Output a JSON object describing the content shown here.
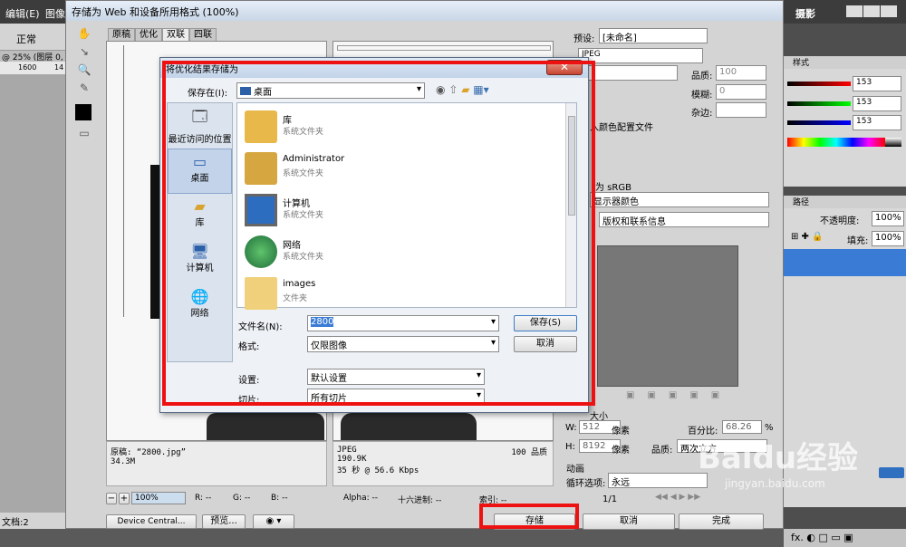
{
  "ps": {
    "menu": [
      "编辑(E)",
      "图像"
    ],
    "mode": "正常",
    "doc_tab": "@ 25% (图层 0,",
    "ruler": [
      "1600",
      "14"
    ],
    "status": "文档:2",
    "right_menu": "摄影",
    "panel_tab": "样式",
    "rgb_values": [
      "153",
      "153",
      "153"
    ],
    "layers_tab": "路径",
    "opacity_label": "不透明度:",
    "opacity_value": "100%",
    "fill_label": "填充:",
    "fill_value": "100%"
  },
  "sfw": {
    "title": "存储为 Web 和设备所用格式 (100%)",
    "tabs": [
      "原稿",
      "优化",
      "双联",
      "四联"
    ],
    "active_tab": 2,
    "preset_label": "预设:",
    "preset_value": "[未命名]",
    "format": "JPEG",
    "quality_label": "品质:",
    "quality_value": "100",
    "blur_label": "模糊:",
    "blur_value": "0",
    "matte_label": "杂边:",
    "embed_label": "入颜色配置文件",
    "convert_label": "为 sRGB",
    "preview_value": "显示器颜色",
    "metadata_value": "版权和联系信息",
    "size_header": "大小",
    "w_label": "W:",
    "w_value": "512",
    "h_label": "H:",
    "h_value": "8192",
    "px_unit": "像素",
    "percent_label": "百分比:",
    "percent_value": "68.26",
    "percent_unit": "%",
    "quality2_label": "品质:",
    "quality2_value": "两次立方",
    "anim_header": "动画",
    "loop_label": "循环选项:",
    "loop_value": "永远",
    "frame_counter": "1/1",
    "orig_info": [
      "原稿: “2800.jpg”",
      "34.3M"
    ],
    "opt_info": [
      "JPEG",
      "190.9K",
      "35 秒 @ 56.6 Kbps"
    ],
    "opt_quality": "100 品质",
    "zoom": "100%",
    "readout": {
      "r": "R: --",
      "g": "G: --",
      "b": "B: --",
      "alpha": "Alpha: --",
      "hex": "十六进制: --",
      "index": "索引: --"
    },
    "device_central": "Device Central...",
    "preview_btn": "预览...",
    "save_btn": "存储",
    "cancel_btn": "取消",
    "done_btn": "完成"
  },
  "saveas": {
    "title": "将优化结果存储为",
    "save_in_label": "保存在(I):",
    "save_in_value": "桌面",
    "places": [
      "最近访问的位置",
      "桌面",
      "库",
      "计算机",
      "网络"
    ],
    "active_place": 1,
    "files": [
      {
        "name": "库",
        "type": "系统文件夹",
        "icon": "library-folder-icon"
      },
      {
        "name": "Administrator",
        "type": "系统文件夹",
        "icon": "user-folder-icon"
      },
      {
        "name": "计算机",
        "type": "系统文件夹",
        "icon": "computer-icon"
      },
      {
        "name": "网络",
        "type": "系统文件夹",
        "icon": "network-icon"
      },
      {
        "name": "images",
        "type": "文件夹",
        "icon": "folder-icon"
      }
    ],
    "filename_label": "文件名(N):",
    "filename_value": "2800",
    "format_label": "格式:",
    "format_value": "仅限图像",
    "settings_label": "设置:",
    "settings_value": "默认设置",
    "slices_label": "切片:",
    "slices_value": "所有切片",
    "save_btn": "保存(S)",
    "cancel_btn": "取消"
  },
  "watermark": {
    "brand": "Baidu经验",
    "url": "jingyan.baidu.com"
  }
}
